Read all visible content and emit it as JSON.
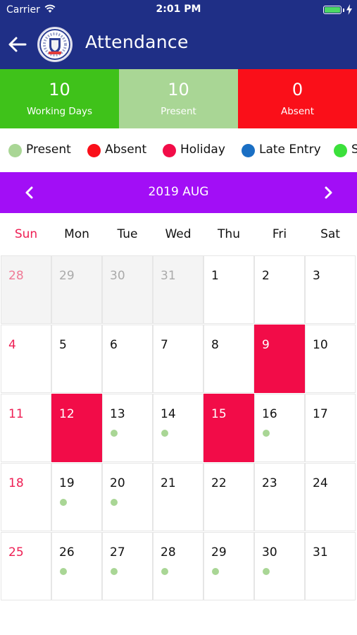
{
  "status_bar": {
    "carrier": "Carrier",
    "time": "2:01 PM"
  },
  "header": {
    "title": "Attendance"
  },
  "stats": [
    {
      "value": "10",
      "label": "Working Days",
      "color": "#3fc21a"
    },
    {
      "value": "10",
      "label": "Present",
      "color": "#a9d695"
    },
    {
      "value": "0",
      "label": "Absent",
      "color": "#fa0f19"
    }
  ],
  "legend": [
    {
      "label": "Present",
      "color": "#a9d695"
    },
    {
      "label": "Absent",
      "color": "#fa0f19"
    },
    {
      "label": "Holiday",
      "color": "#f20c48"
    },
    {
      "label": "Late Entry",
      "color": "#1a6fc4"
    },
    {
      "label": "S",
      "color": "#3be03b"
    }
  ],
  "calendar": {
    "month_label": "2019 AUG",
    "weekdays": [
      "Sun",
      "Mon",
      "Tue",
      "Wed",
      "Thu",
      "Fri",
      "Sat"
    ],
    "weeks": [
      [
        {
          "day": "28",
          "other": true
        },
        {
          "day": "29",
          "other": true
        },
        {
          "day": "30",
          "other": true
        },
        {
          "day": "31",
          "other": true
        },
        {
          "day": "1"
        },
        {
          "day": "2"
        },
        {
          "day": "3"
        }
      ],
      [
        {
          "day": "4"
        },
        {
          "day": "5"
        },
        {
          "day": "6"
        },
        {
          "day": "7"
        },
        {
          "day": "8"
        },
        {
          "day": "9",
          "status": "holiday"
        },
        {
          "day": "10"
        }
      ],
      [
        {
          "day": "11"
        },
        {
          "day": "12",
          "status": "holiday"
        },
        {
          "day": "13",
          "status": "present"
        },
        {
          "day": "14",
          "status": "present"
        },
        {
          "day": "15",
          "status": "holiday"
        },
        {
          "day": "16",
          "status": "present"
        },
        {
          "day": "17"
        }
      ],
      [
        {
          "day": "18"
        },
        {
          "day": "19",
          "status": "present"
        },
        {
          "day": "20",
          "status": "present"
        },
        {
          "day": "21"
        },
        {
          "day": "22"
        },
        {
          "day": "23"
        },
        {
          "day": "24"
        }
      ],
      [
        {
          "day": "25"
        },
        {
          "day": "26",
          "status": "present"
        },
        {
          "day": "27",
          "status": "present"
        },
        {
          "day": "28",
          "status": "present"
        },
        {
          "day": "29",
          "status": "present"
        },
        {
          "day": "30",
          "status": "present"
        },
        {
          "day": "31"
        }
      ]
    ]
  }
}
